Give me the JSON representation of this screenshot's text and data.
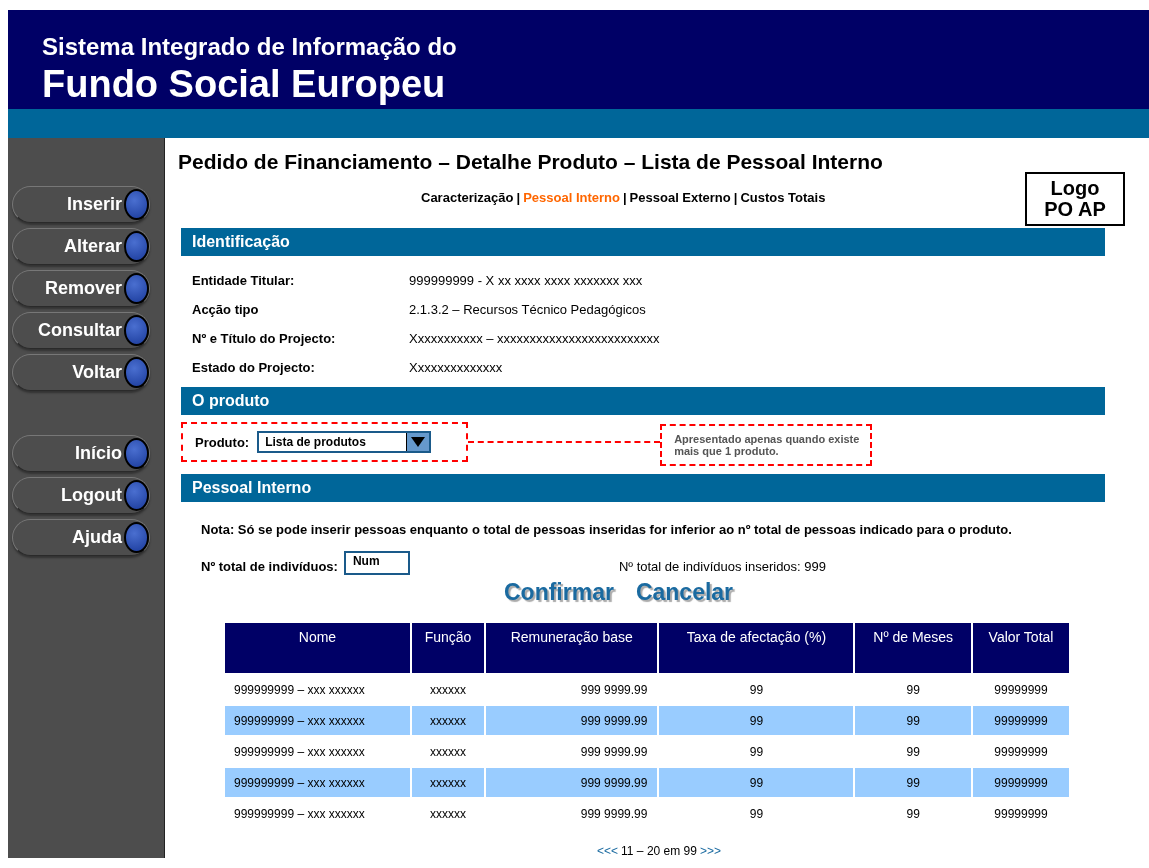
{
  "header": {
    "subtitle": "Sistema Integrado de Informação do",
    "title": "Fundo Social Europeu"
  },
  "sidebar": {
    "groups": [
      [
        {
          "label": "Inserir"
        },
        {
          "label": "Alterar"
        },
        {
          "label": "Remover"
        },
        {
          "label": "Consultar"
        },
        {
          "label": "Voltar"
        }
      ],
      [
        {
          "label": "Início"
        },
        {
          "label": "Logout"
        },
        {
          "label": "Ajuda"
        }
      ]
    ]
  },
  "page_title": "Pedido de Financiamento – Detalhe Produto – Lista de Pessoal Interno",
  "logo": {
    "line1": "Logo",
    "line2": "PO AP"
  },
  "tab_separator": "|",
  "tabs": [
    {
      "label": "Caracterização",
      "selected": false
    },
    {
      "label": "Pessoal Interno",
      "selected": true
    },
    {
      "label": "Pessoal Externo",
      "selected": false
    },
    {
      "label": "Custos Totais",
      "selected": false
    }
  ],
  "identificacao": {
    "heading": "Identificação",
    "fields": [
      {
        "label": "Entidade Titular:",
        "value": "999999999 - X xx xxxx xxxx xxxxxxx xxx"
      },
      {
        "label": "Acção tipo",
        "value": "2.1.3.2 – Recursos Técnico Pedagógicos"
      },
      {
        "label": "Nº e Título do Projecto:",
        "value": "Xxxxxxxxxxx – xxxxxxxxxxxxxxxxxxxxxxxxx"
      },
      {
        "label": "Estado do Projecto:",
        "value": "Xxxxxxxxxxxxxx"
      }
    ]
  },
  "produto": {
    "heading": "O produto",
    "label": "Produto:",
    "select_value": "Lista de produtos",
    "annotation": "Apresentado apenas quando existe mais que 1 produto."
  },
  "pessoal": {
    "heading": "Pessoal Interno",
    "note": "Nota: Só se pode inserir pessoas enquanto o total de pessoas inseridas for inferior ao nº total de pessoas indicado para o produto.",
    "total_label": "Nº total de indivíduos:",
    "total_value": "Num",
    "inserted": "Nº total de indivíduos inseridos: 999",
    "actions": [
      "Confirmar",
      "Cancelar"
    ]
  },
  "table": {
    "columns": [
      "Nome",
      "Função",
      "Remuneração base",
      "Taxa de afectação (%)",
      "Nº de Meses",
      "Valor Total"
    ],
    "rows": [
      {
        "highlighted": false,
        "cells": [
          "999999999 – xxx xxxxxx",
          "xxxxxx",
          "999 9999.99",
          "99",
          "99",
          "99999999"
        ]
      },
      {
        "highlighted": true,
        "cells": [
          "999999999 – xxx xxxxxx",
          "xxxxxx",
          "999 9999.99",
          "99",
          "99",
          "99999999"
        ]
      },
      {
        "highlighted": false,
        "cells": [
          "999999999 – xxx xxxxxx",
          "xxxxxx",
          "999 9999.99",
          "99",
          "99",
          "99999999"
        ]
      },
      {
        "highlighted": true,
        "cells": [
          "999999999 – xxx xxxxxx",
          "xxxxxx",
          "999 9999.99",
          "99",
          "99",
          "99999999"
        ]
      },
      {
        "highlighted": false,
        "cells": [
          "999999999 – xxx xxxxxx",
          "xxxxxx",
          "999 9999.99",
          "99",
          "99",
          "99999999"
        ]
      }
    ]
  },
  "pagination": {
    "prev": "<<<",
    "range": "11 – 20 em 99",
    "next": ">>>"
  }
}
